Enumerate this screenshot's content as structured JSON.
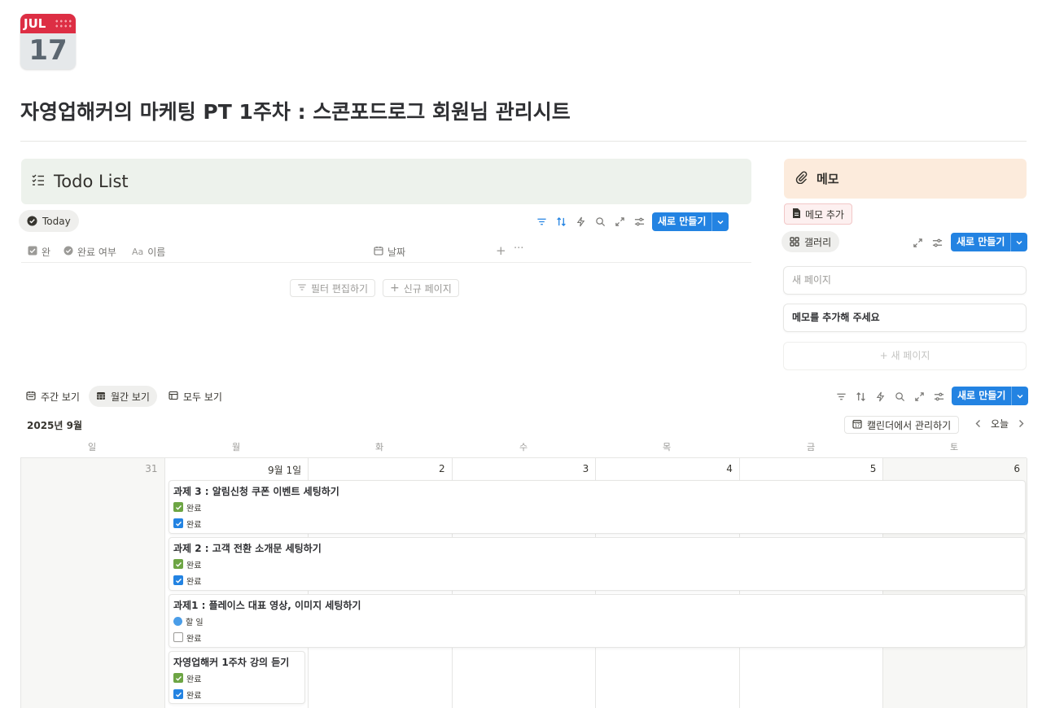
{
  "page": {
    "icon": {
      "name": "calendar-icon",
      "month": "JUL",
      "day": "17"
    },
    "title": "자영업해커의 마케팅 PT 1주차 : 스콘포드로그 회원님 관리시트"
  },
  "todo": {
    "callout_title": "Todo List",
    "view_tab": "Today",
    "new_button": "새로 만들기",
    "columns": {
      "done": "완",
      "status": "완료 여부",
      "name": "이름",
      "date": "날짜"
    },
    "edit_filter": "필터 편집하기",
    "new_page": "신규 페이지"
  },
  "memo": {
    "callout_title": "메모",
    "tag": "메모 추가",
    "view_tab": "갤러리",
    "new_button": "새로 만들기",
    "cards": [
      "새 페이지",
      "메모를 추가해 주세요"
    ],
    "add_page": "새 페이지"
  },
  "calendar": {
    "tabs": [
      "주간 보기",
      "월간 보기",
      "모두 보기"
    ],
    "new_button": "새로 만들기",
    "month": "2025년 9월",
    "manage_button": "캘린더에서 관리하기",
    "today_button": "오늘",
    "weekdays": [
      "일",
      "월",
      "화",
      "수",
      "목",
      "금",
      "토"
    ],
    "days": [
      "31",
      "9월 1일",
      "2",
      "3",
      "4",
      "5",
      "6"
    ],
    "events": [
      {
        "title": "과제 3 : 알림신청 쿠폰 이벤트 세팅하기",
        "status": "완료",
        "done": "완료"
      },
      {
        "title": "과제 2 : 고객 전환 소개문 세팅하기",
        "status": "완료",
        "done": "완료"
      },
      {
        "title": "과제1 : 플레이스 대표 영상, 이미지 세팅하기",
        "status": "할 일",
        "done": "완료"
      },
      {
        "title": "자영업해커 1주차 강의 듣기",
        "status": "완료",
        "done": "완료"
      }
    ]
  },
  "colors": {
    "accent": "#2383e2",
    "todo_callout": "#edf2ec",
    "memo_callout": "#fcebdc",
    "check_green": "#6da544"
  }
}
